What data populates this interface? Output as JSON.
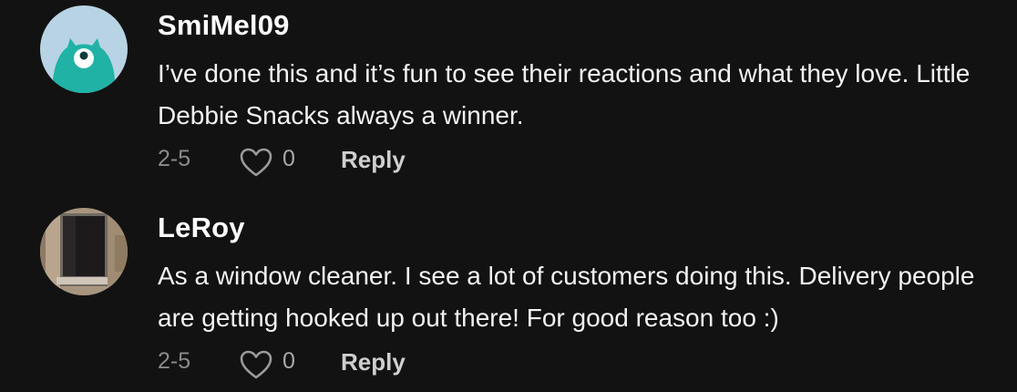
{
  "comments": [
    {
      "username": "SmiMel09",
      "avatar_icon": "teal-monster-avatar-icon",
      "text": "I’ve done this and it’s fun to see their reactions and what they love. Little Debbie Snacks always a winner.",
      "date": "2-5",
      "like_icon": "heart-outline-icon",
      "likes": "0",
      "reply_label": "Reply"
    },
    {
      "username": "LeRoy",
      "avatar_icon": "window-photo-avatar-icon",
      "text": "As a window cleaner. I see a lot of customers doing this. Delivery people are getting hooked up out there! For good reason too :)",
      "date": "2-5",
      "like_icon": "heart-outline-icon",
      "likes": "0",
      "reply_label": "Reply"
    }
  ],
  "colors": {
    "background": "#121212",
    "username": "#ffffff",
    "body_text": "#f2f2f2",
    "meta_text": "#8a8a8a",
    "avatar_sky": "#b7d3e3",
    "avatar_monster": "#1fb3a6"
  }
}
